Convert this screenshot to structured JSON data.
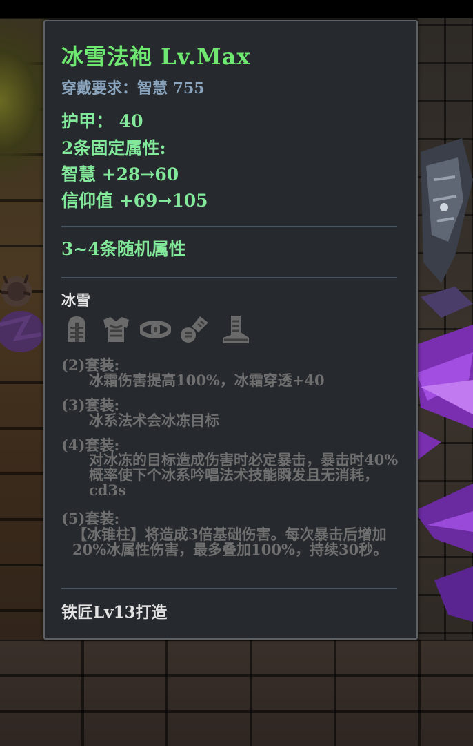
{
  "item": {
    "title": "冰雪法袍  Lv.Max",
    "requirement": "穿戴要求：智慧  755",
    "armor": "护甲：  40",
    "fixed_header": "2条固定属性:",
    "fixed_attrs": [
      "智慧  +28→60",
      "信仰值  +69→105"
    ],
    "random_attrs": "3~4条随机属性",
    "crafted_by": "铁匠Lv13打造"
  },
  "set": {
    "name": "冰雪",
    "piece_icons": [
      "helmet-icon",
      "chest-armor-icon",
      "belt-icon",
      "gloves-icon",
      "boots-icon"
    ],
    "bonuses": [
      {
        "header": "(2)套装:",
        "text": "冰霜伤害提高100%，冰霜穿透+40"
      },
      {
        "header": "(3)套装:",
        "text": "冰系法术会冰冻目标"
      },
      {
        "header": "(4)套装:",
        "text": "对冰冻的目标造成伤害时必定暴击，暴击时40%概率使下个冰系吟唱法术技能瞬发且无消耗，cd3s"
      },
      {
        "header": "(5)套装:",
        "text": "【冰锥柱】将造成3倍基础伤害。每次暴击后增加20%冰属性伤害，最多叠加100%，持续30秒。"
      }
    ]
  },
  "colors": {
    "panel_bg": "#262a2e",
    "title_green": "#6ee870",
    "attr_green": "#82e89a",
    "requirement_blue": "#8aa4bd",
    "inactive_gray": "#6f6f6f"
  }
}
